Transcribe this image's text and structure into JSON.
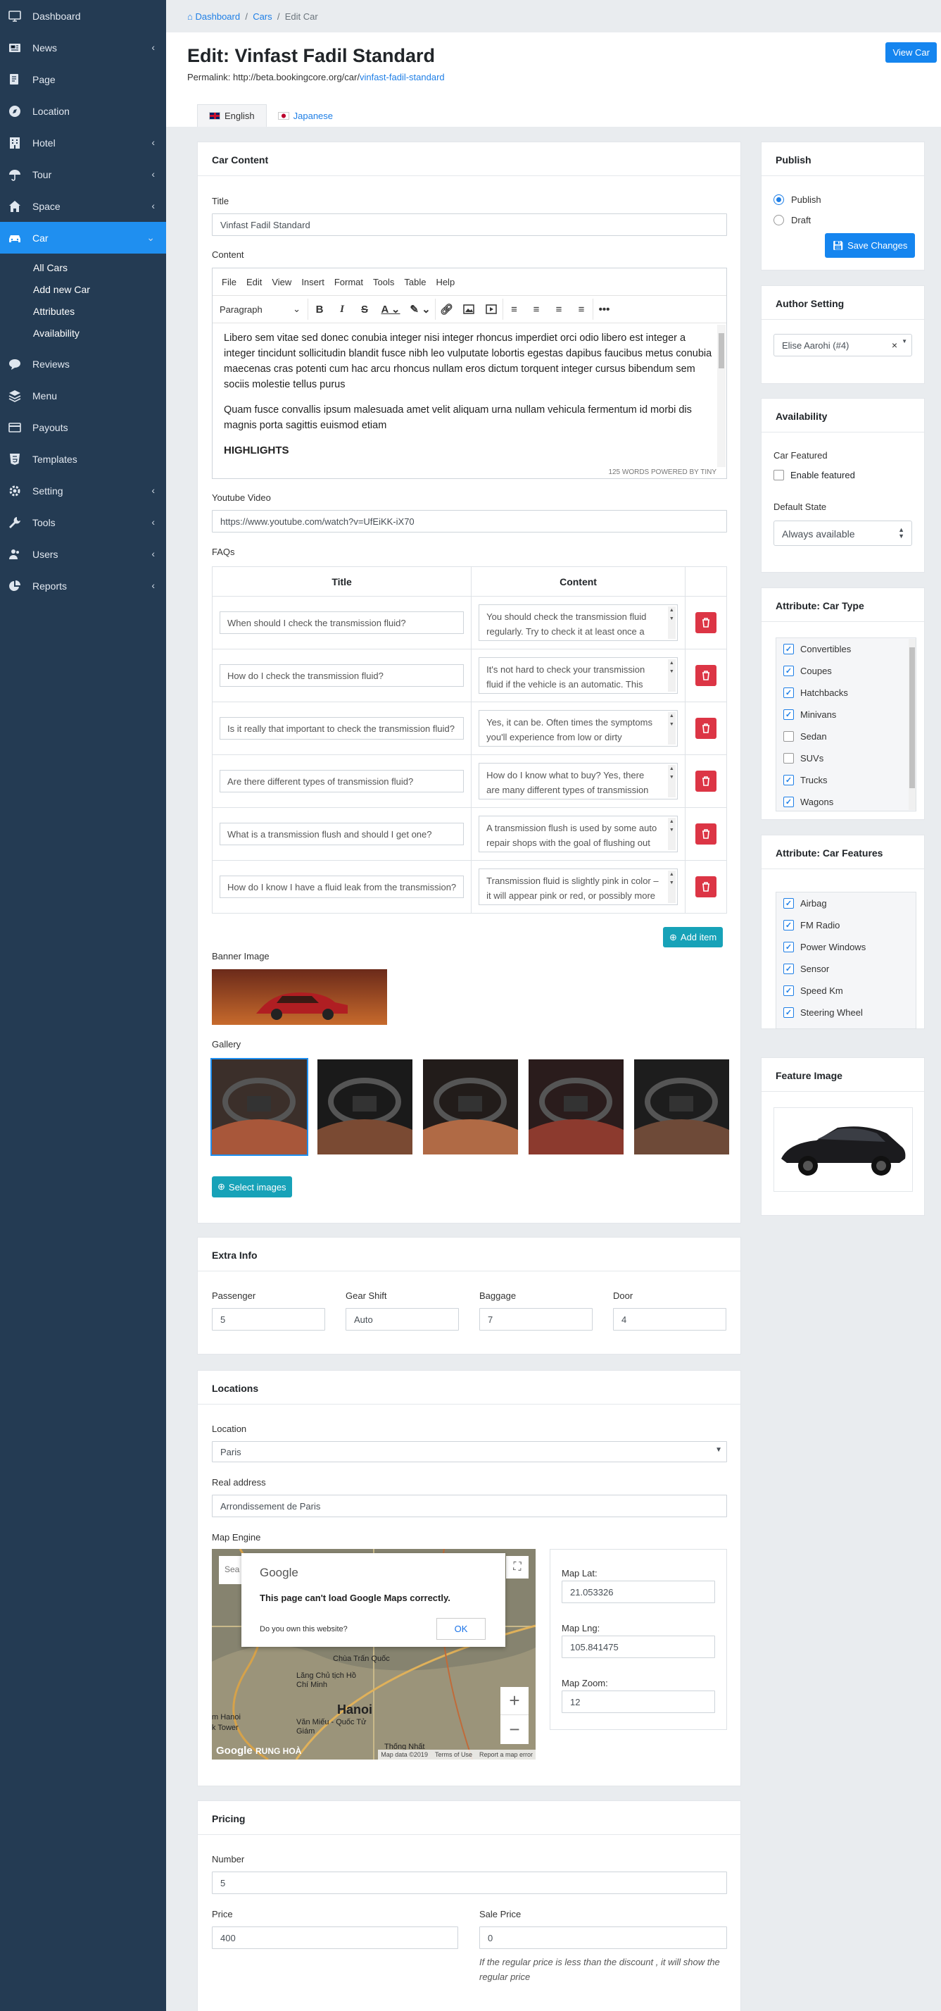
{
  "sidebar": {
    "items": [
      {
        "label": "Dashboard",
        "icon": "monitor-icon",
        "chevron": false
      },
      {
        "label": "News",
        "icon": "newspaper-icon",
        "chevron": true
      },
      {
        "label": "Page",
        "icon": "page-icon",
        "chevron": false
      },
      {
        "label": "Location",
        "icon": "compass-icon",
        "chevron": false
      },
      {
        "label": "Hotel",
        "icon": "building-icon",
        "chevron": true
      },
      {
        "label": "Tour",
        "icon": "umbrella-icon",
        "chevron": true
      },
      {
        "label": "Space",
        "icon": "home-icon",
        "chevron": true
      },
      {
        "label": "Car",
        "icon": "car-icon",
        "chevron": true,
        "active": true
      }
    ],
    "car_sub": [
      "All Cars",
      "Add new Car",
      "Attributes",
      "Availability"
    ],
    "items2": [
      {
        "label": "Reviews",
        "icon": "comment-icon",
        "chevron": false
      },
      {
        "label": "Menu",
        "icon": "layers-icon",
        "chevron": false
      },
      {
        "label": "Payouts",
        "icon": "credit-card-icon",
        "chevron": false
      },
      {
        "label": "Templates",
        "icon": "html5-icon",
        "chevron": false
      },
      {
        "label": "Setting",
        "icon": "gear-icon",
        "chevron": true
      },
      {
        "label": "Tools",
        "icon": "wrench-icon",
        "chevron": true
      },
      {
        "label": "Users",
        "icon": "users-icon",
        "chevron": true
      },
      {
        "label": "Reports",
        "icon": "pie-chart-icon",
        "chevron": true
      }
    ]
  },
  "breadcrumb": {
    "home": "Dashboard",
    "cars": "Cars",
    "current": "Edit Car",
    "sep": "/"
  },
  "header": {
    "title": "Edit: Vinfast Fadil Standard",
    "permalink_label": "Permalink: http://beta.bookingcore.org/car/",
    "permalink_slug": "vinfast-fadil-standard",
    "view_button": "View Car"
  },
  "lang_tabs": [
    "English",
    "Japanese"
  ],
  "car_content": {
    "title": "Car Content",
    "title_label": "Title",
    "title_value": "Vinfast Fadil Standard",
    "content_label": "Content",
    "menubar": [
      "File",
      "Edit",
      "View",
      "Insert",
      "Format",
      "Tools",
      "Table",
      "Help"
    ],
    "format_select": "Paragraph",
    "paragraph1": "Libero sem vitae sed donec conubia integer nisi integer rhoncus imperdiet orci odio libero est integer a integer tincidunt sollicitudin blandit fusce nibh leo vulputate lobortis egestas dapibus faucibus metus conubia maecenas cras potenti cum hac arcu rhoncus nullam eros dictum torquent integer cursus bibendum sem sociis molestie tellus purus",
    "paragraph2": "Quam fusce convallis ipsum malesuada amet velit aliquam urna nullam vehicula fermentum id morbi dis magnis porta sagittis euismod etiam",
    "heading": "HIGHLIGHTS",
    "status": "125 WORDS  POWERED BY TINY",
    "youtube_label": "Youtube Video",
    "youtube_value": "https://www.youtube.com/watch?v=UfEiKK-iX70",
    "faqs_label": "FAQs",
    "faq_col_title": "Title",
    "faq_col_content": "Content",
    "faqs": [
      {
        "title": "When should I check the transmission fluid?",
        "content": "You should check the transmission fluid regularly. Try to check it at least once a month or at the"
      },
      {
        "title": "How do I check the transmission fluid?",
        "content": "It's not hard to check your transmission fluid if the vehicle is an automatic. This link to the"
      },
      {
        "title": "Is it really that important to check the transmission fluid?",
        "content": "Yes, it can be. Often times the symptoms you'll experience from low or dirty transmission fluid"
      },
      {
        "title": "Are there different types of transmission fluid?",
        "content": "How do I know what to buy? Yes, there are many different types of transmission fluid, each"
      },
      {
        "title": "What is a transmission flush and should I get one?",
        "content": "A transmission flush is used by some auto repair shops with the goal of flushing out debris.  Auto"
      },
      {
        "title": "How do I know I have a fluid leak from the transmission?",
        "content": "Transmission fluid is slightly pink in color – it will appear pink or red, or possibly more brownish if"
      }
    ],
    "add_item": "Add item",
    "banner_label": "Banner Image",
    "gallery_label": "Gallery",
    "select_images": "Select images"
  },
  "extra_info": {
    "title": "Extra Info",
    "fields": [
      {
        "label": "Passenger",
        "value": "5"
      },
      {
        "label": "Gear Shift",
        "value": "Auto"
      },
      {
        "label": "Baggage",
        "value": "7"
      },
      {
        "label": "Door",
        "value": "4"
      }
    ]
  },
  "locations": {
    "title": "Locations",
    "location_label": "Location",
    "location_value": "Paris",
    "address_label": "Real address",
    "address_value": "Arrondissement de Paris",
    "map_label": "Map Engine",
    "map_search_placeholder": "Sea",
    "map_dialog": {
      "brand": "Google",
      "message": "This page can't load Google Maps correctly.",
      "question": "Do you own this website?",
      "ok": "OK"
    },
    "map_city": "Hanoi",
    "map_places": [
      "Chùa Trấn Quốc",
      "Lăng Chủ tịch Hồ Chí Minh",
      "m Hanoi",
      "k Tower",
      "Văn Miếu - Quốc Tử Giám",
      "Thống Nhất",
      "RUNG HOÀ"
    ],
    "map_footer": [
      "Map data ©2019",
      "Terms of Use",
      "Report a map error"
    ],
    "lat_label": "Map Lat:",
    "lat_value": "21.053326",
    "lng_label": "Map Lng:",
    "lng_value": "105.841475",
    "zoom_label": "Map Zoom:",
    "zoom_value": "12"
  },
  "pricing": {
    "title": "Pricing",
    "number_label": "Number",
    "number_value": "5",
    "price_label": "Price",
    "price_value": "400",
    "sale_label": "Sale Price",
    "sale_value": "0",
    "note": "If the regular price is less than the discount , it will show the regular price"
  },
  "publish": {
    "title": "Publish",
    "options": [
      "Publish",
      "Draft"
    ],
    "selected": "Publish",
    "save": "Save Changes"
  },
  "author": {
    "title": "Author Setting",
    "value": "Elise Aarohi (#4)",
    "clear": "×"
  },
  "availability": {
    "title": "Availability",
    "featured_label": "Car Featured",
    "featured_check": "Enable featured",
    "default_state_label": "Default State",
    "default_state_value": "Always available"
  },
  "car_type": {
    "title": "Attribute: Car Type",
    "items": [
      {
        "label": "Convertibles",
        "checked": true
      },
      {
        "label": "Coupes",
        "checked": true
      },
      {
        "label": "Hatchbacks",
        "checked": true
      },
      {
        "label": "Minivans",
        "checked": true
      },
      {
        "label": "Sedan",
        "checked": false
      },
      {
        "label": "SUVs",
        "checked": false
      },
      {
        "label": "Trucks",
        "checked": true
      },
      {
        "label": "Wagons",
        "checked": true
      }
    ]
  },
  "car_features": {
    "title": "Attribute: Car Features",
    "items": [
      {
        "label": "Airbag",
        "checked": true
      },
      {
        "label": "FM Radio",
        "checked": true
      },
      {
        "label": "Power Windows",
        "checked": true
      },
      {
        "label": "Sensor",
        "checked": true
      },
      {
        "label": "Speed Km",
        "checked": true
      },
      {
        "label": "Steering Wheel",
        "checked": true
      }
    ]
  },
  "feature_image": {
    "title": "Feature Image"
  },
  "colors": {
    "sidebar": "#243b53",
    "active": "#1f8ff0",
    "primary": "#1585ef",
    "danger": "#dc3545",
    "teal": "#17a2b8"
  }
}
